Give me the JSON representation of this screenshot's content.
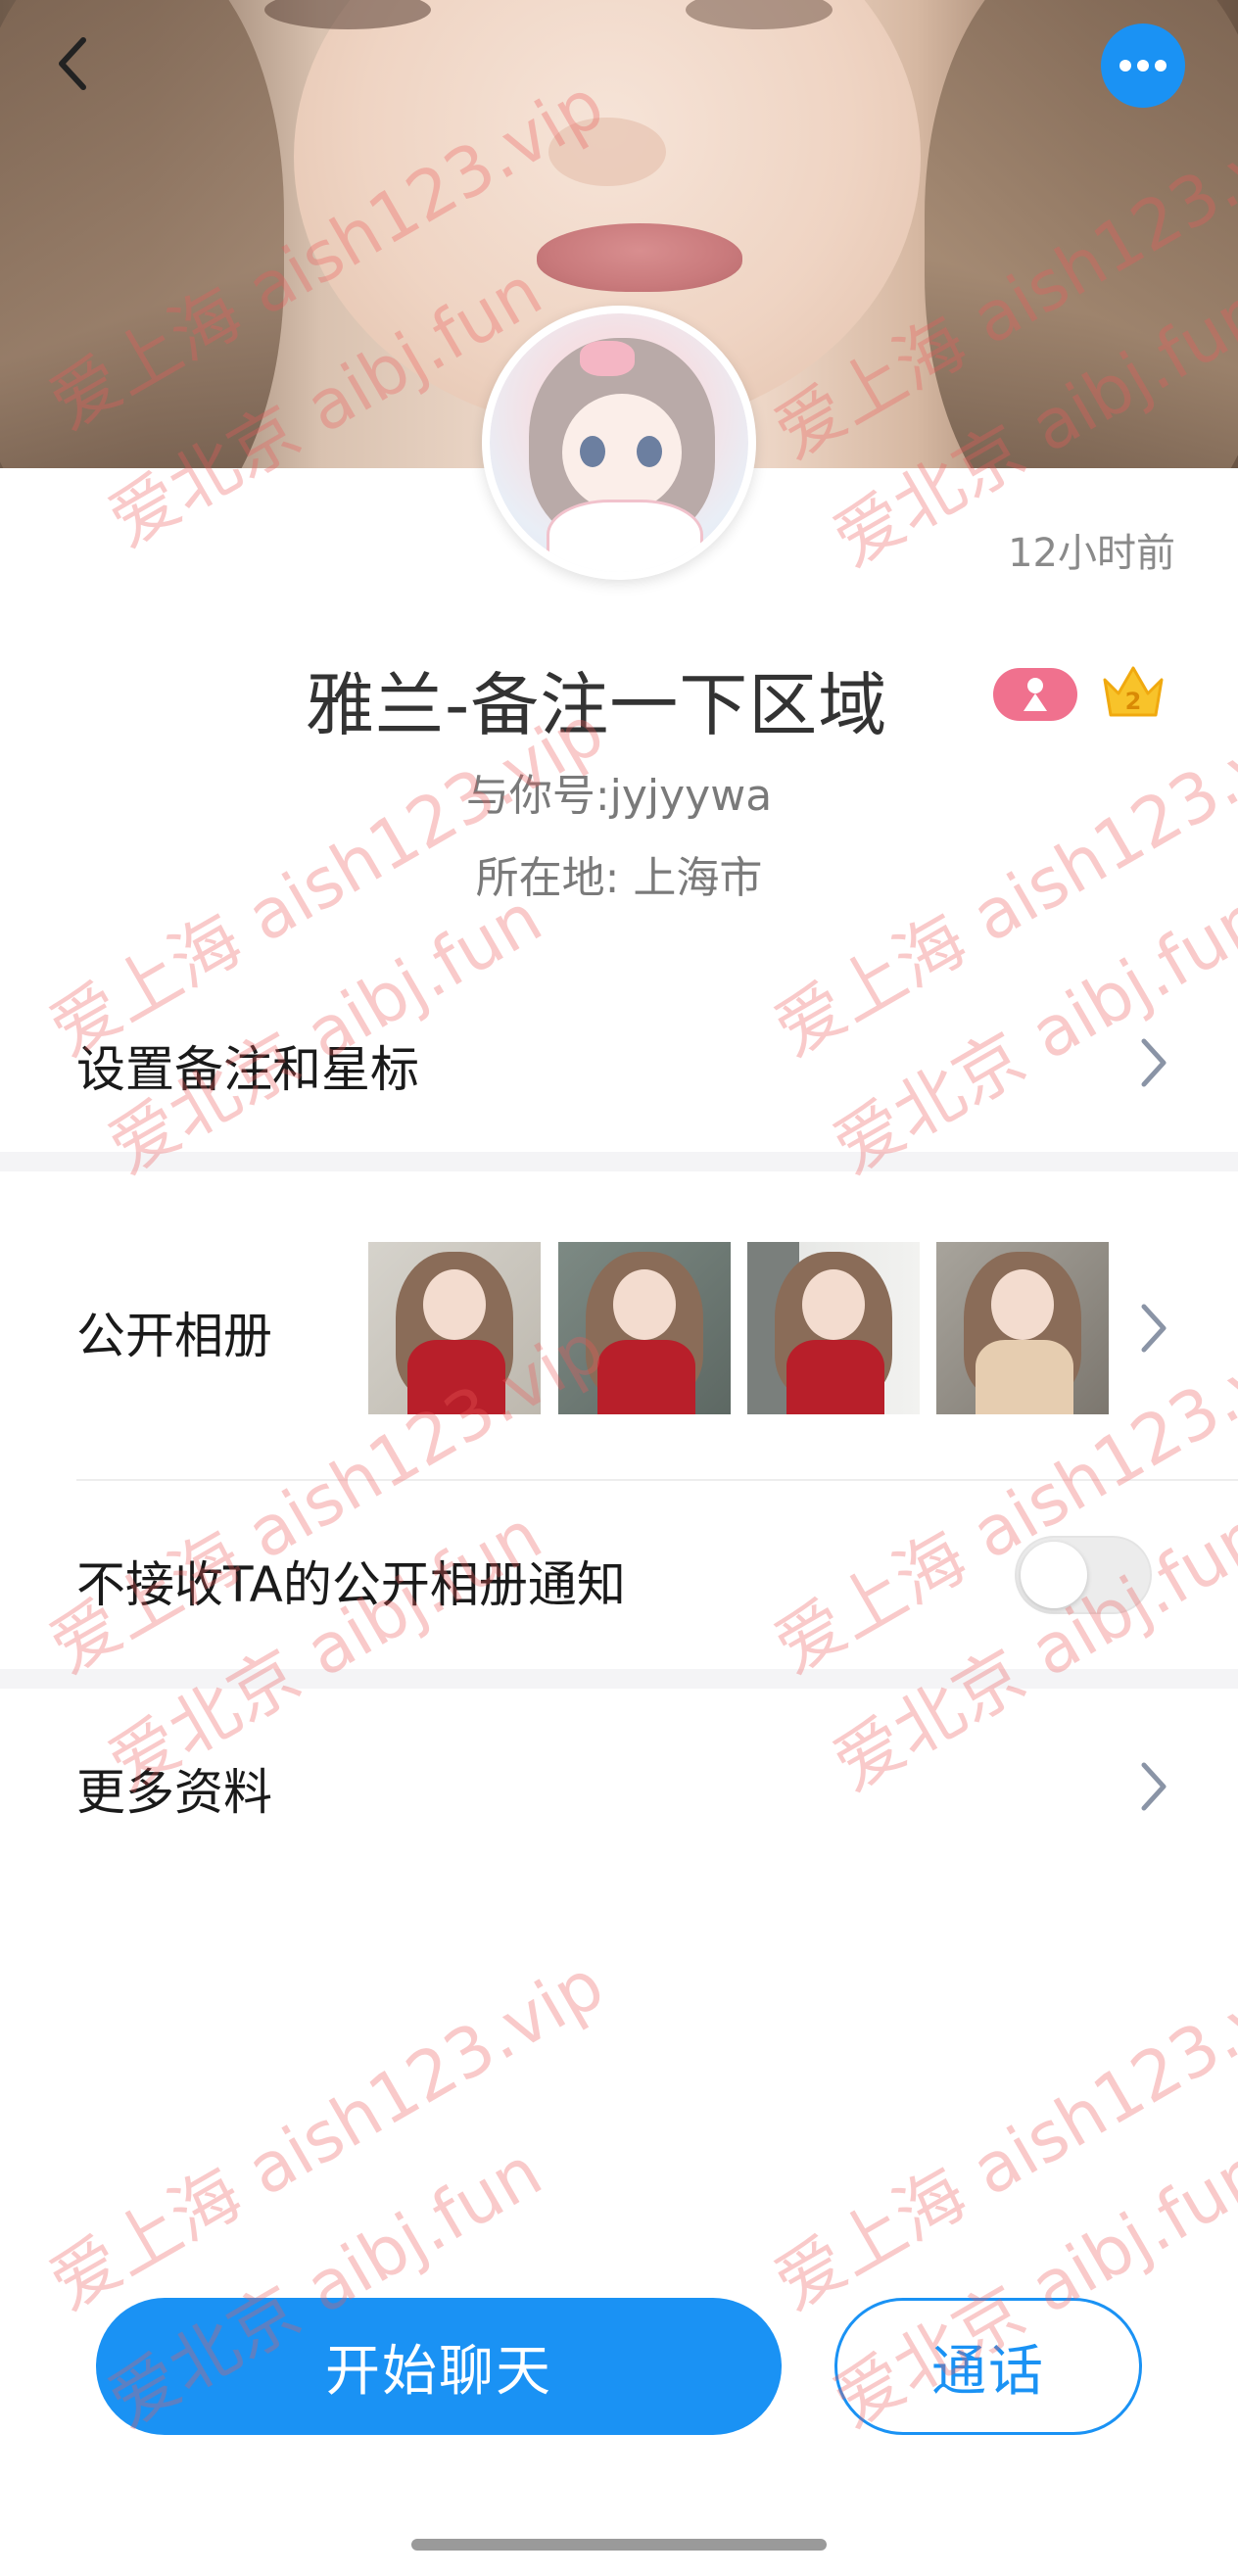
{
  "header": {
    "back_icon": "chevron-left-icon",
    "more_icon": "more-dots-icon",
    "accent_color": "#1a92f4"
  },
  "profile": {
    "time_ago": "12小时前",
    "name": "雅兰-备注一下区域",
    "gender_badge": "female-icon",
    "level_badge": "2",
    "account": "与你号:jyjyywa",
    "location": "所在地: 上海市"
  },
  "rows": {
    "remark_label": "设置备注和星标",
    "album_label": "公开相册",
    "album_notify_label": "不接收TA的公开相册通知",
    "album_notify_enabled": false,
    "more_info_label": "更多资料"
  },
  "actions": {
    "chat_label": "开始聊天",
    "call_label": "通话"
  },
  "watermark": {
    "line1": "爱上海 aish123.vip",
    "line2": "爱北京 aibj.fun"
  }
}
